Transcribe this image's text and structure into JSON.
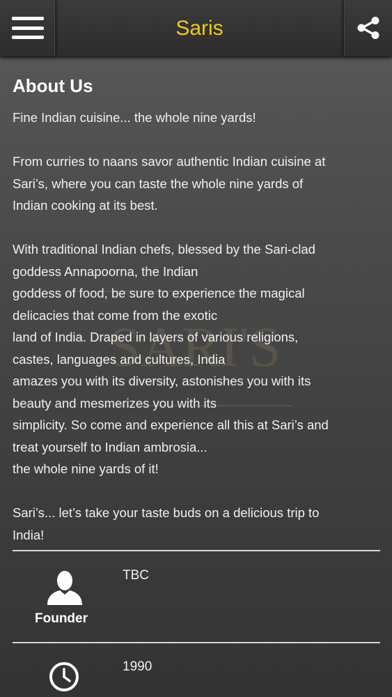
{
  "header": {
    "title": "Saris",
    "menu_icon": "hamburger-menu-icon",
    "share_icon": "share-icon"
  },
  "watermark": {
    "text": "SARI'S"
  },
  "about": {
    "heading": "About Us",
    "paragraphs": [
      [
        "Fine Indian cuisine... the whole nine yards!"
      ],
      [
        "From curries to naans savor authentic Indian cuisine at",
        "Sari’s, where you can taste the whole nine yards of",
        "Indian cooking at its best."
      ],
      [
        "With traditional Indian chefs, blessed by the Sari-clad",
        "goddess Annapoorna, the Indian",
        "goddess of food, be sure to experience the magical",
        "delicacies that come from the exotic",
        "land of India. Draped in layers of various religions,",
        "castes, languages and cultures, India",
        "amazes you with its diversity, astonishes you with its",
        "beauty and mesmerizes you with its",
        "simplicity. So come and experience all this at Sari’s and",
        "treat yourself to Indian ambrosia...",
        "the whole nine yards of it!"
      ],
      [
        "Sari’s... let’s take your taste buds on a delicious trip to",
        "India!"
      ]
    ]
  },
  "info": {
    "founder": {
      "icon": "person-icon",
      "label": "Founder",
      "value": "TBC"
    },
    "founded": {
      "icon": "clock-icon",
      "value": "1990"
    }
  },
  "colors": {
    "title": "#efc91e",
    "header_bg": "#2d2d2d",
    "text": "#f0f0f0"
  }
}
